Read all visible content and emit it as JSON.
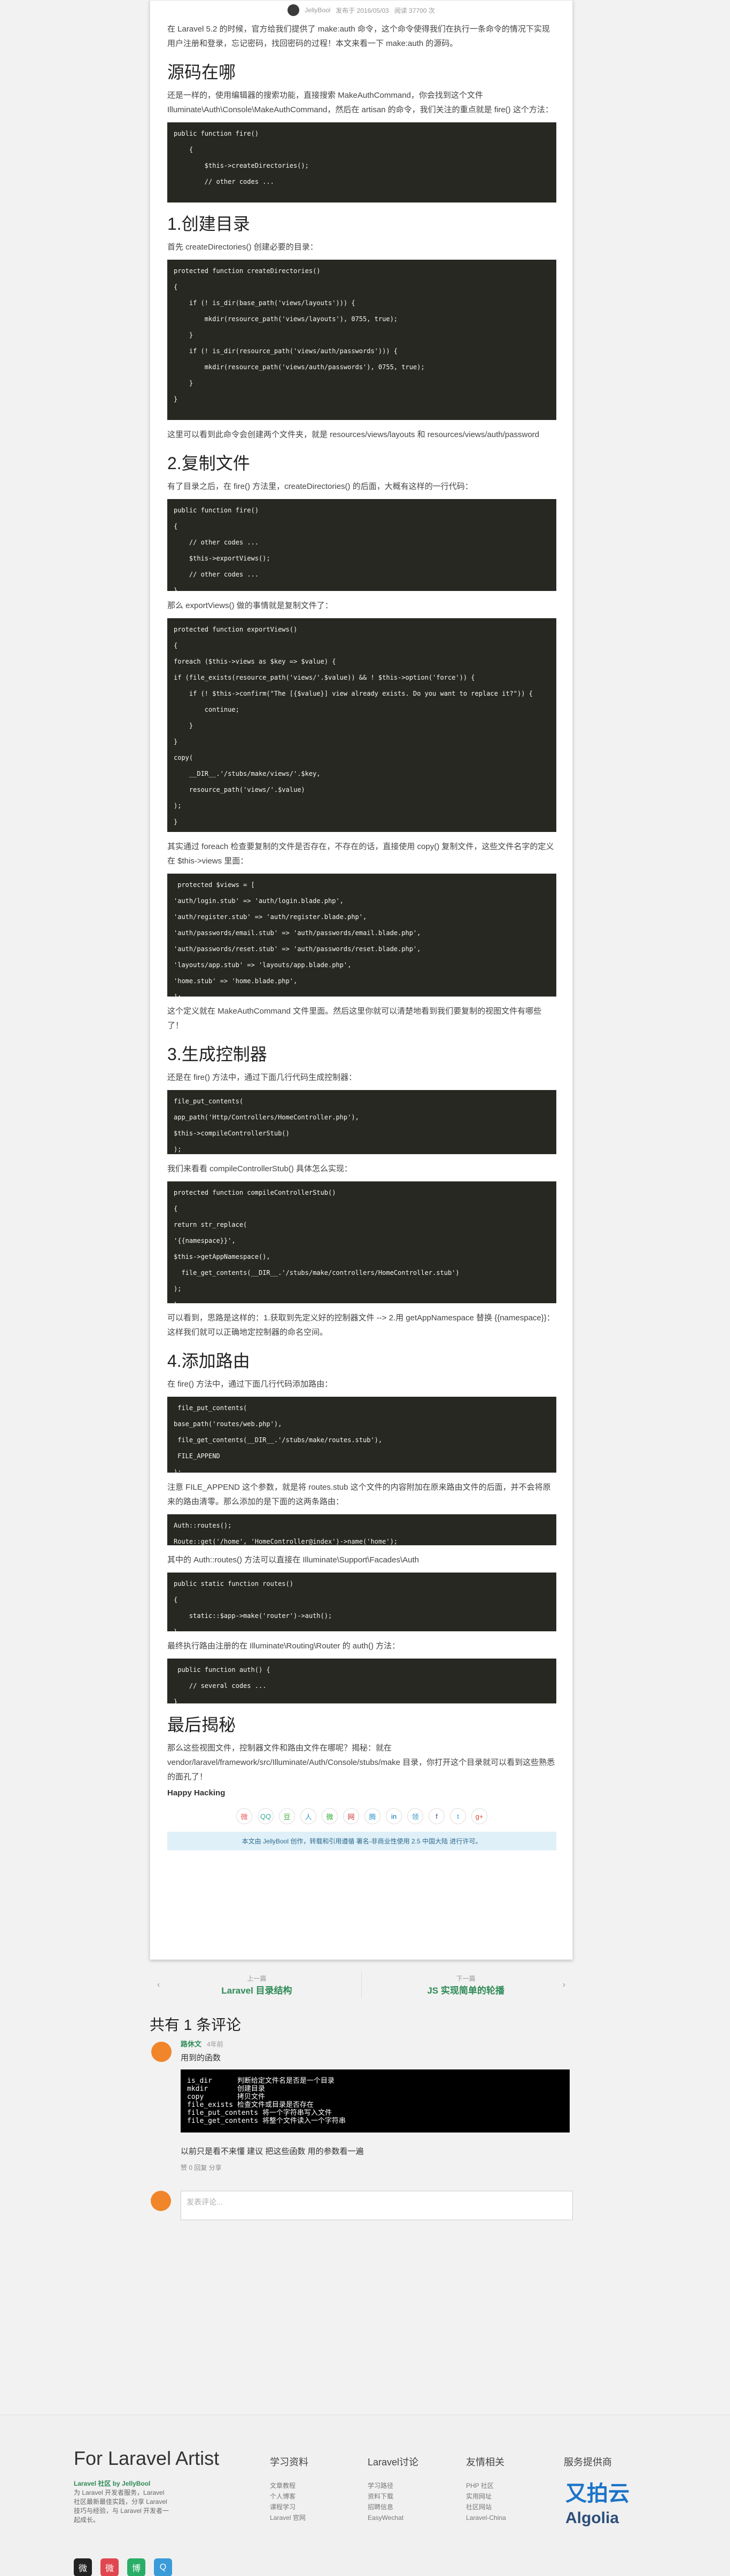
{
  "meta": {
    "author": "JellyBool",
    "date": "发布于 2016/05/03",
    "views": "阅读 37700 次"
  },
  "intro": "在 Laravel 5.2 的时候，官方给我们提供了 make:auth 命令，这个命令使得我们在执行一条命令的情况下实现用户注册和登录，忘记密码，找回密码的过程！本文来看一下 make:auth 的源码。",
  "s1": {
    "title": "源码在哪",
    "text": "还是一样的，使用编辑器的搜索功能，直接搜索 MakeAuthCommand，你会找到这个文件 Illuminate\\Auth\\Console\\MakeAuthCommand，然后在 artisan 的命令，我们关注的重点就是 fire() 这个方法：",
    "code": "public function fire()\n    {\n        $this->createDirectories();\n        // other codes ..."
  },
  "s2": {
    "title": "1.创建目录",
    "text": "首先 createDirectories() 创建必要的目录：",
    "code": "protected function createDirectories()\n{\n    if (! is_dir(base_path('views/layouts'))) {\n        mkdir(resource_path('views/layouts'), 0755, true);\n    }\n    if (! is_dir(resource_path('views/auth/passwords'))) {\n        mkdir(resource_path('views/auth/passwords'), 0755, true);\n    }\n}",
    "after": "这里可以看到此命令会创建两个文件夹，就是 resources/views/layouts 和 resources/views/auth/password"
  },
  "s3": {
    "title": "2.复制文件",
    "text": "有了目录之后，在 fire() 方法里，createDirectories() 的后面，大概有这样的一行代码：",
    "code1": "public function fire()\n{\n    // other codes ...\n    $this->exportViews();\n    // other codes ...\n}",
    "text2": "那么 exportViews() 做的事情就是复制文件了：",
    "code2": "protected function exportViews()\n{\nforeach ($this->views as $key => $value) {\nif (file_exists(resource_path('views/'.$value)) && ! $this->option('force')) {\n    if (! $this->confirm(\"The [{$value}] view already exists. Do you want to replace it?\")) {\n        continue;\n    }\n}\ncopy(\n    __DIR__.'/stubs/make/views/'.$key,\n    resource_path('views/'.$value)\n);\n}\n}",
    "text3": "其实通过 foreach 检查要复制的文件是否存在，不存在的话，直接使用 copy() 复制文件，这些文件名字的定义在 $this->views 里面：",
    "code3": " protected $views = [\n'auth/login.stub' => 'auth/login.blade.php',\n'auth/register.stub' => 'auth/register.blade.php',\n'auth/passwords/email.stub' => 'auth/passwords/email.blade.php',\n'auth/passwords/reset.stub' => 'auth/passwords/reset.blade.php',\n'layouts/app.stub' => 'layouts/app.blade.php',\n'home.stub' => 'home.blade.php',\n];",
    "after": "这个定义就在 MakeAuthCommand 文件里面。然后这里你就可以清楚地看到我们要复制的视图文件有哪些了！"
  },
  "s4": {
    "title": "3.生成控制器",
    "text": "还是在 fire() 方法中，通过下面几行代码生成控制器：",
    "code1": "file_put_contents(\napp_path('Http/Controllers/HomeController.php'),\n$this->compileControllerStub()\n);",
    "text2": "我们来看看 compileControllerStub() 具体怎么实现：",
    "code2": "protected function compileControllerStub()\n{\nreturn str_replace(\n'{{namespace}}',\n$this->getAppNamespace(),\n  file_get_contents(__DIR__.'/stubs/make/controllers/HomeController.stub')\n);\n}",
    "after": "可以看到，思路是这样的：1.获取到先定义好的控制器文件 --> 2.用 getAppNamespace 替换 {{namespace}}：这样我们就可以正确地定控制器的命名空间。"
  },
  "s5": {
    "title": "4.添加路由",
    "text": "在 fire() 方法中，通过下面几行代码添加路由：",
    "code1": " file_put_contents(\nbase_path('routes/web.php'),\n file_get_contents(__DIR__.'/stubs/make/routes.stub'),\n FILE_APPEND\n);",
    "text2": "注意 FILE_APPEND 这个参数，就是将 routes.stub 这个文件的内容附加在原来路由文件的后面，并不会将原来的路由清零。那么添加的是下面的这两条路由：",
    "code2": "Auth::routes();\nRoute::get('/home', 'HomeController@index')->name('home');",
    "text3": "其中的 Auth::routes() 方法可以直接在 Illuminate\\Support\\Facades\\Auth",
    "code3": "public static function routes()\n{\n    static::$app->make('router')->auth();\n}",
    "text4": "最终执行路由注册的在 Illuminate\\Routing\\Router 的 auth() 方法：",
    "code4": " public function auth() {\n    // several codes ...\n}"
  },
  "s6": {
    "title": "最后揭秘",
    "text": "那么这些视图文件，控制器文件和路由文件在哪呢？揭秘：就在 vendor/laravel/framework/src/Illuminate/Auth/Console/stubs/make 目录，你打开这个目录就可以看到这些熟悉的面孔了！",
    "happy": "Happy Hacking"
  },
  "share": [
    "微",
    "QQ",
    "豆",
    "人",
    "微",
    "网",
    "腾",
    "in",
    "领",
    "f",
    "t",
    "g+"
  ],
  "notice": "本文由 JellyBool 创作，转载和引用遵循 署名-非商业性使用 2.5 中国大陆 进行许可。",
  "pager": {
    "prev_label": "上一篇",
    "prev_title": "Laravel 目录结构",
    "next_label": "下一篇",
    "next_title": "JS 实现简单的轮播"
  },
  "comments": {
    "title": "共有 1 条评论",
    "name": "路休文",
    "time": "4年前",
    "text": "用到的函数",
    "code": "is_dir      判断给定文件名是否是一个目录\nmkdir       创建目录\ncopy        拷贝文件\nfile_exists 检查文件或目录是否存在\nfile_put_contents 将一个字符串写入文件\nfile_get_contents 将整个文件读入一个字符串",
    "footer_text": "以前只是看不来懂 建议 把这些函数 用的参数看一遍",
    "actions": "赞 0   回复   分享",
    "placeholder": "发表评论..."
  },
  "footer": {
    "title": "For Laravel Artist",
    "desc_author": "Laravel 社区 by JellyBool",
    "desc": "为 Laravel 开发者服务，Laravel 社区最新最佳实践，分享 Laravel 技巧与经验，与 Laravel 开发者一起成长。",
    "cols": [
      {
        "title": "学习资料",
        "items": [
          "文章教程",
          "个人博客",
          "课程学习",
          "Laravel 官网"
        ]
      },
      {
        "title": "Laravel讨论",
        "items": [
          "学习路径",
          "资料下载",
          "招聘信息",
          "EasyWechat"
        ]
      },
      {
        "title": "友情相关",
        "items": [
          "PHP 社区",
          "实用网址",
          "社区网站",
          "Laravel-China"
        ]
      },
      {
        "title": "服务提供商",
        "items": []
      }
    ],
    "upyun": "又拍云",
    "algolia": "Algolia",
    "social": [
      "微",
      "微",
      "博",
      "Q"
    ]
  }
}
